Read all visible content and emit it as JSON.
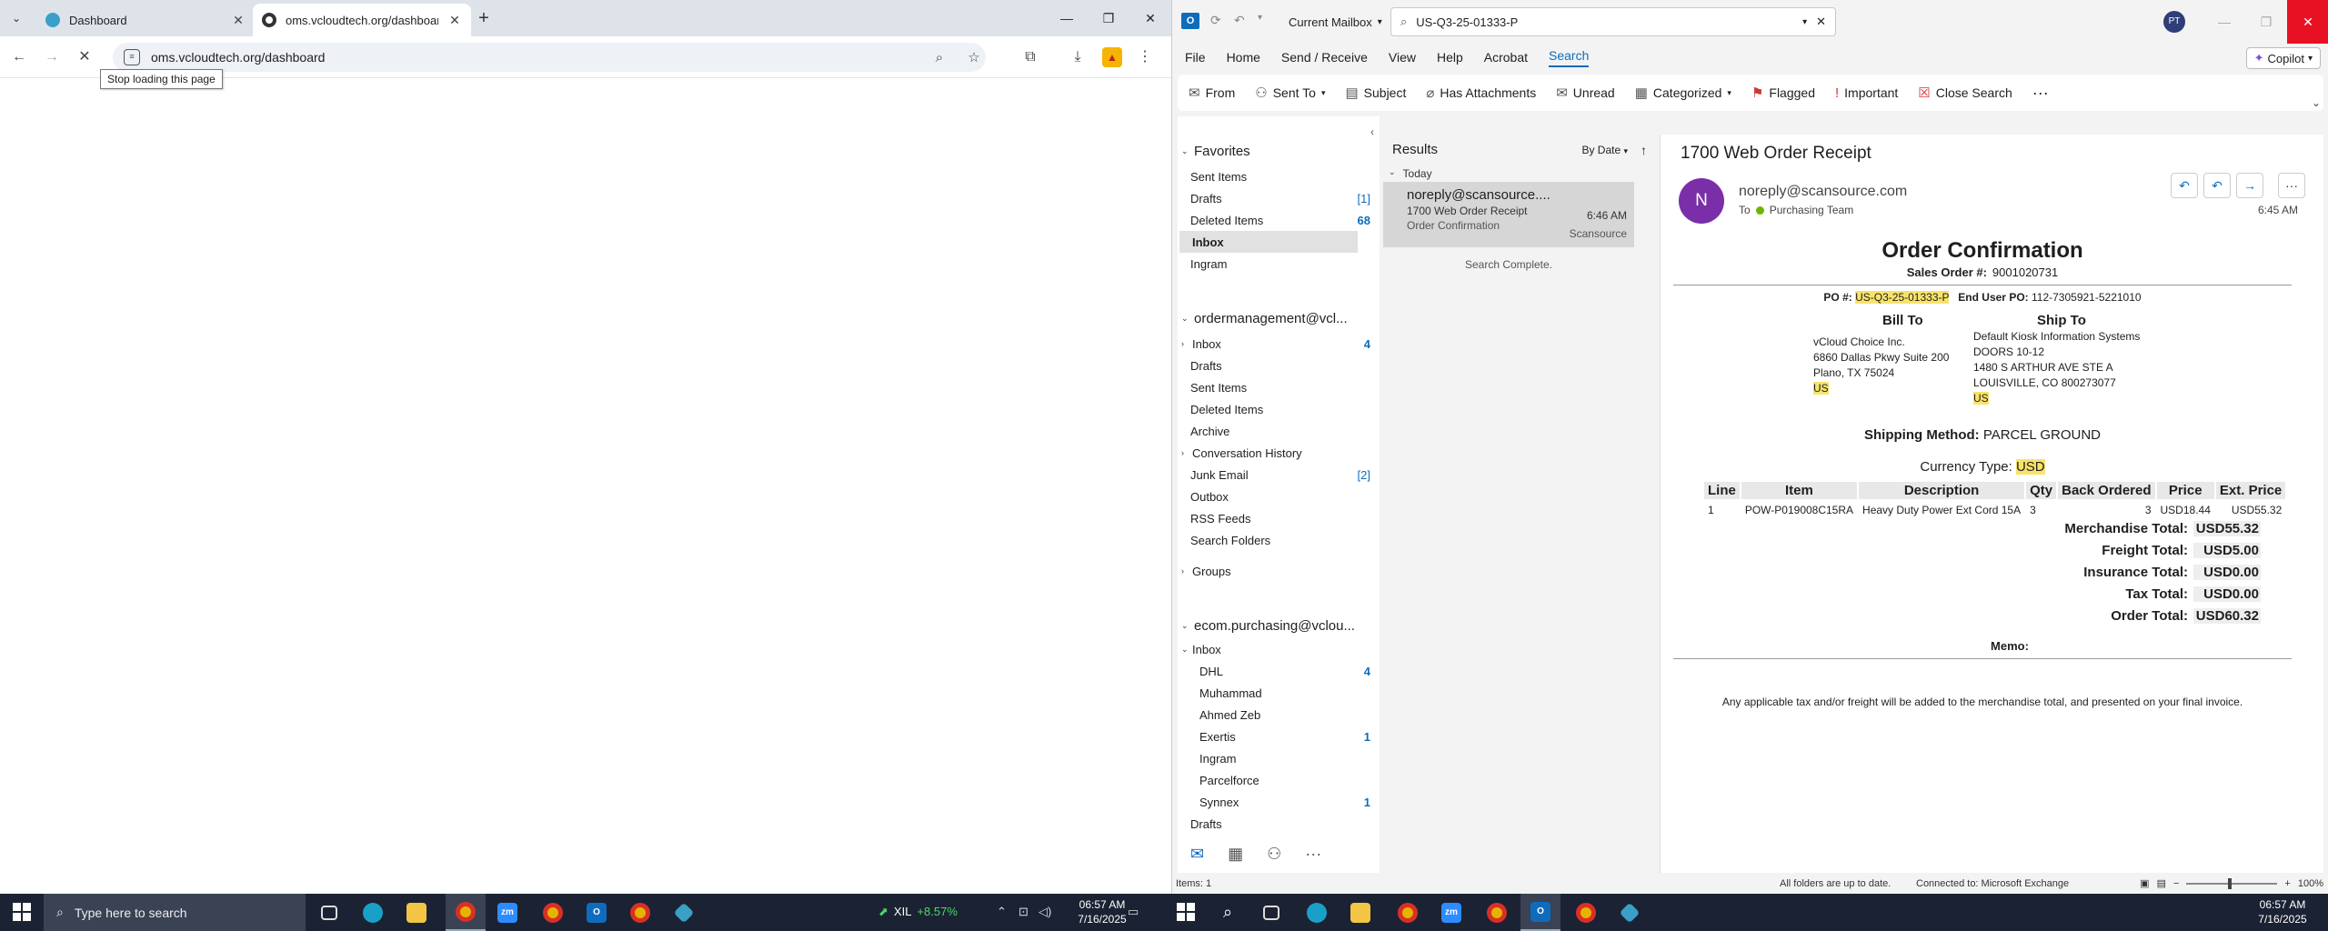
{
  "chrome": {
    "tabs": [
      {
        "title": "Dashboard",
        "active": false
      },
      {
        "title": "oms.vcloudtech.org/dashboard",
        "active": true
      }
    ],
    "url": "oms.vcloudtech.org/dashboard",
    "tooltip": "Stop loading this page"
  },
  "outlook": {
    "scope": "Current Mailbox",
    "search_value": "US-Q3-25-01333-P",
    "user_initials": "PT",
    "menu": [
      "File",
      "Home",
      "Send / Receive",
      "View",
      "Help",
      "Acrobat",
      "Search"
    ],
    "copilot": "Copilot",
    "ribbon": [
      "From",
      "Sent To",
      "Subject",
      "Has Attachments",
      "Unread",
      "Categorized",
      "Flagged",
      "Important",
      "Close Search"
    ],
    "favorites": {
      "header": "Favorites",
      "items": [
        {
          "label": "Sent Items",
          "count": ""
        },
        {
          "label": "Drafts",
          "count": "[1]"
        },
        {
          "label": "Deleted Items",
          "count": "68"
        },
        {
          "label": "Inbox",
          "count": ""
        },
        {
          "label": "Ingram",
          "count": ""
        }
      ]
    },
    "account1": {
      "header": "ordermanagement@vcl...",
      "items": [
        {
          "label": "Inbox",
          "count": "4"
        },
        {
          "label": "Drafts",
          "count": ""
        },
        {
          "label": "Sent Items",
          "count": ""
        },
        {
          "label": "Deleted Items",
          "count": ""
        },
        {
          "label": "Archive",
          "count": ""
        },
        {
          "label": "Conversation History",
          "count": ""
        },
        {
          "label": "Junk Email",
          "count": "[2]"
        },
        {
          "label": "Outbox",
          "count": ""
        },
        {
          "label": "RSS Feeds",
          "count": ""
        },
        {
          "label": "Search Folders",
          "count": ""
        }
      ],
      "groups": "Groups"
    },
    "account2": {
      "header": "ecom.purchasing@vclou...",
      "inbox": "Inbox",
      "subfolders": [
        {
          "label": "DHL",
          "count": "4"
        },
        {
          "label": "Muhammad",
          "count": ""
        },
        {
          "label": "Ahmed Zeb",
          "count": ""
        },
        {
          "label": "Exertis",
          "count": "1"
        },
        {
          "label": "Ingram",
          "count": ""
        },
        {
          "label": "Parcelforce",
          "count": ""
        },
        {
          "label": "Synnex",
          "count": "1"
        }
      ],
      "drafts": "Drafts"
    },
    "results": {
      "title": "Results",
      "sort": "By Date",
      "group": "Today",
      "status": "Search Complete."
    },
    "message": {
      "from": "noreply@scansource....",
      "subject": "1700 Web Order Receipt",
      "preview": "Order Confirmation",
      "time": "6:46 AM",
      "tag": "Scansource"
    },
    "reading": {
      "subject": "1700 Web Order Receipt",
      "avatar": "N",
      "sender": "noreply@scansource.com",
      "to_label": "To",
      "to": "Purchasing Team",
      "time": "6:45 AM"
    },
    "receipt": {
      "title": "Order Confirmation",
      "sales_label": "Sales Order #:",
      "sales_no": "9001020731",
      "po_label": "PO #:",
      "po_no": "US-Q3-25-01333-P",
      "enduser_label": "End User PO:",
      "enduser_no": "112-7305921-5221010",
      "bill_to_h": "Bill To",
      "ship_to_h": "Ship To",
      "bill_to": [
        "vCloud Choice Inc.",
        "6860 Dallas Pkwy Suite 200",
        "Plano, TX 75024",
        "US"
      ],
      "ship_to": [
        "Default Kiosk Information Systems",
        "DOORS 10-12",
        "1480 S ARTHUR AVE STE A",
        "LOUISVILLE, CO 800273077",
        "US"
      ],
      "ship_method_label": "Shipping Method:",
      "ship_method": "PARCEL GROUND",
      "currency_label": "Currency Type:",
      "currency": "USD",
      "columns": [
        "Line",
        "Item",
        "Description",
        "Qty",
        "Back Ordered",
        "Price",
        "Ext. Price"
      ],
      "rows": [
        [
          "1",
          "POW-P019008C15RA",
          "Heavy Duty Power Ext Cord 15A",
          "3",
          "3",
          "USD18.44",
          "USD55.32"
        ]
      ],
      "totals": [
        {
          "label": "Merchandise Total:",
          "amount": "USD55.32"
        },
        {
          "label": "Freight Total:",
          "amount": "USD5.00"
        },
        {
          "label": "Insurance Total:",
          "amount": "USD0.00"
        },
        {
          "label": "Tax Total:",
          "amount": "USD0.00"
        },
        {
          "label": "Order Total:",
          "amount": "USD60.32"
        }
      ],
      "memo": "Memo:",
      "note": "Any applicable tax and/or freight will be added to the merchandise total, and presented on your final invoice."
    },
    "statusbar": {
      "items": "Items: 1",
      "sync": "All folders are up to date.",
      "connection": "Connected to: Microsoft Exchange",
      "zoom": "100%"
    }
  },
  "taskbar": {
    "search_placeholder": "Type here to search",
    "ticker_symbol": "XIL",
    "ticker_change": "+8.57%",
    "time": "06:57 AM",
    "date": "7/16/2025"
  },
  "colors": {
    "accent": "#0f6cbd",
    "highlight": "#f7e36a",
    "taskbar": "#1b2233"
  }
}
